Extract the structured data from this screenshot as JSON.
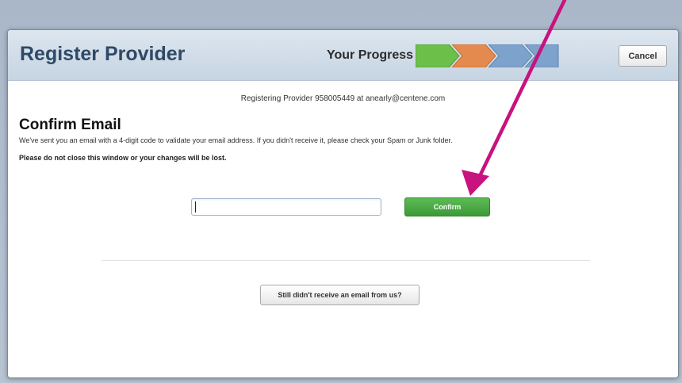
{
  "modal": {
    "title": "Register Provider",
    "progress_label": "Your Progress",
    "progress_steps": [
      {
        "state": "complete",
        "color": "#6cc04a"
      },
      {
        "state": "current",
        "color": "#e58a4e"
      },
      {
        "state": "pending",
        "color": "#7da2cc"
      },
      {
        "state": "pending",
        "color": "#7da2cc"
      }
    ],
    "cancel_label": "Cancel"
  },
  "body": {
    "registering_prefix": "Registering Provider 958005449 at ",
    "registering_email": "anearly@centene.com",
    "heading": "Confirm Email",
    "instructions": "We've sent you an email with a 4-digit code to validate your email address. If you didn't receive it, please check your Spam or Junk folder.",
    "warning": "Please do not close this window or your changes will be lost.",
    "code_input_value": "",
    "confirm_label": "Confirm",
    "resend_label": "Still didn't receive an email from us?"
  },
  "annotation": {
    "arrow_color": "#c8127e"
  }
}
